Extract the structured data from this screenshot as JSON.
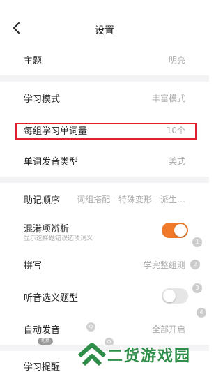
{
  "header": {
    "title": "设置"
  },
  "rows": {
    "theme": {
      "label": "主题",
      "value": "明亮"
    },
    "study_mode": {
      "label": "学习模式",
      "value": "丰富模式"
    },
    "words_per_group": {
      "label": "每组学习单词量",
      "value": "10个"
    },
    "pronunciation": {
      "label": "单词发音类型",
      "value": "美式"
    },
    "mnemonic_order": {
      "label": "助记顺序",
      "value": "词组搭配 - 特殊变形 - 派生…"
    },
    "confusing_items": {
      "label": "混淆项辨析",
      "sub": "显示选择题错误选项词义",
      "toggle_on": true
    },
    "spelling": {
      "label": "拼写",
      "value": "学完整组测"
    },
    "listening_quiz": {
      "label": "听音选义题型",
      "toggle_on": false
    },
    "auto_pronounce": {
      "label": "自动发音",
      "value": "全部开启"
    },
    "study_reminder": {
      "label": "学习提醒"
    }
  },
  "markers": {
    "m1": "1",
    "m2": "2",
    "m3": "3",
    "m4": "4",
    "q": "Q",
    "o": "O"
  },
  "pill": "切换",
  "watermark": {
    "text": "二货游戏园"
  },
  "colors": {
    "accent": "#f07a2a",
    "highlight": "#e0202e",
    "watermark": "#2f8f4a"
  }
}
